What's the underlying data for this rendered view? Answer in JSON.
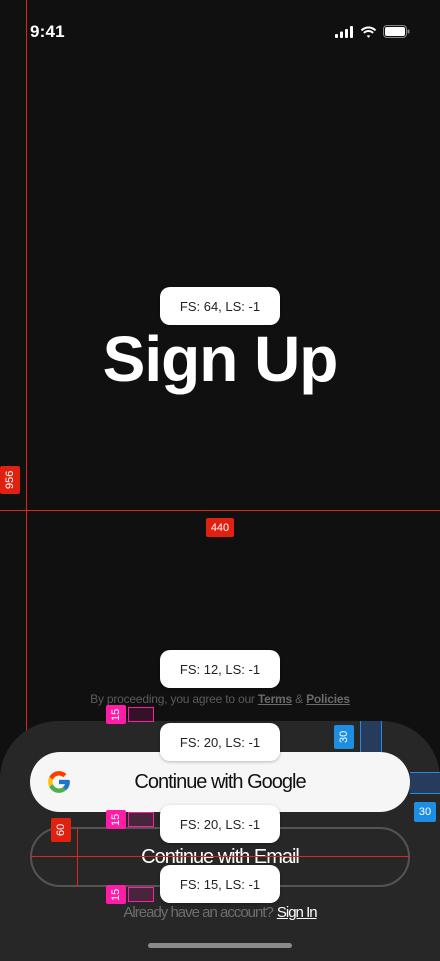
{
  "status_bar": {
    "time": "9:41"
  },
  "title": "Sign Up",
  "terms": {
    "prefix": "By proceeding, you agree to our ",
    "terms_link": "Terms",
    "joiner": " & ",
    "policies_link": "Policies"
  },
  "buttons": {
    "google": "Continue with Google",
    "email": "Continue with Email"
  },
  "signin": {
    "prompt": "Already have an account?",
    "link": "Sign In"
  },
  "annotations": {
    "title_spec": "FS: 64, LS: -1",
    "terms_spec": "FS: 12, LS: -1",
    "google_spec": "FS: 20, LS: -1",
    "email_spec": "FS: 20, LS: -1",
    "signin_spec": "FS: 15, LS: -1",
    "height": "956",
    "width": "440",
    "gap1": "15",
    "gap2": "15",
    "gap3": "15",
    "button_height": "60",
    "padding_top": "30",
    "padding_side": "30"
  },
  "colors": {
    "background": "#111010",
    "sheet": "#272727",
    "google_button": "#f6f6f6",
    "annotation_red": "#e0210f",
    "annotation_pink": "#ff1ca6",
    "annotation_blue": "#1d8ee2"
  }
}
